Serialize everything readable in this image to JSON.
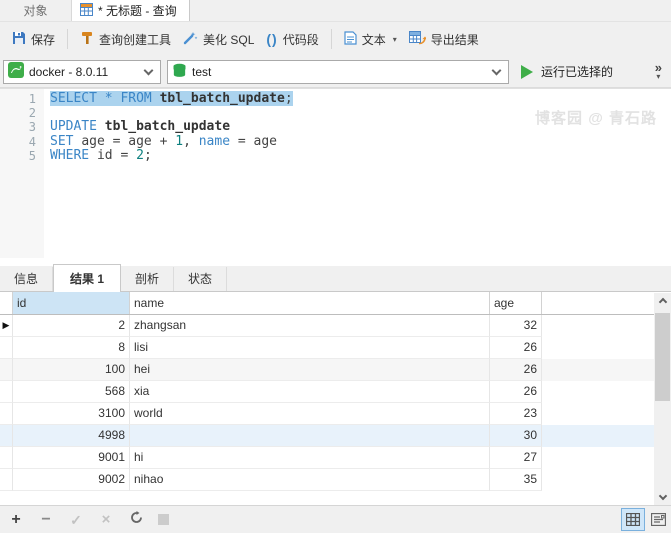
{
  "window_tabs": {
    "objects": {
      "label": "对象"
    },
    "query": {
      "label": "* 无标题 - 查询"
    }
  },
  "toolbar": {
    "save": "保存",
    "query_builder": "查询创建工具",
    "beautify_sql": "美化 SQL",
    "snippet": "代码段",
    "snippet_glyph": "()",
    "text_mode": "文本",
    "export_result": "导出结果",
    "dropdown_glyph": "▾"
  },
  "connection_bar": {
    "connection": "docker - 8.0.11",
    "database": "test",
    "run_selected": "运行已选择的",
    "overflow": "»",
    "overflow_more": "▾"
  },
  "editor": {
    "watermark": "博客园 @ 青石路",
    "lines": [
      {
        "num": "1",
        "selected": true,
        "tokens": [
          {
            "t": "SELECT * FROM ",
            "c": "kw"
          },
          {
            "t": "tbl_batch_update",
            "c": "tbl"
          },
          {
            "t": ";",
            "c": "tx"
          }
        ]
      },
      {
        "num": "2",
        "selected": false,
        "tokens": []
      },
      {
        "num": "3",
        "selected": false,
        "tokens": [
          {
            "t": "UPDATE ",
            "c": "kw"
          },
          {
            "t": "tbl_batch_update",
            "c": "tbl"
          }
        ]
      },
      {
        "num": "4",
        "selected": false,
        "tokens": [
          {
            "t": "SET ",
            "c": "kw"
          },
          {
            "t": "age = age + ",
            "c": "tx"
          },
          {
            "t": "1",
            "c": "num"
          },
          {
            "t": ", ",
            "c": "tx"
          },
          {
            "t": "name",
            "c": "kw"
          },
          {
            "t": " = age",
            "c": "tx"
          }
        ]
      },
      {
        "num": "5",
        "selected": false,
        "tokens": [
          {
            "t": "WHERE ",
            "c": "kw"
          },
          {
            "t": "id = ",
            "c": "tx"
          },
          {
            "t": "2",
            "c": "num"
          },
          {
            "t": ";",
            "c": "tx"
          }
        ]
      }
    ]
  },
  "result_tabs": {
    "info": {
      "label": "信息"
    },
    "result1": {
      "label": "结果 1"
    },
    "profile": {
      "label": "剖析"
    },
    "status": {
      "label": "状态"
    }
  },
  "result_table": {
    "columns": {
      "id": "id",
      "name": "name",
      "age": "age"
    },
    "row_marker": "▶",
    "rows": [
      {
        "id": "2",
        "name": "zhangsan",
        "age": "32",
        "highlight": "none",
        "marker": true
      },
      {
        "id": "8",
        "name": "lisi",
        "age": "26",
        "highlight": "none",
        "marker": false
      },
      {
        "id": "100",
        "name": "hei",
        "age": "26",
        "highlight": "gray",
        "marker": false
      },
      {
        "id": "568",
        "name": "xia",
        "age": "26",
        "highlight": "none",
        "marker": false
      },
      {
        "id": "3100",
        "name": "world",
        "age": "23",
        "highlight": "none",
        "marker": false
      },
      {
        "id": "4998",
        "name": "",
        "age": "30",
        "highlight": "blue",
        "marker": false
      },
      {
        "id": "9001",
        "name": "hi",
        "age": "27",
        "highlight": "none",
        "marker": false
      },
      {
        "id": "9002",
        "name": "nihao",
        "age": "35",
        "highlight": "none",
        "marker": false
      }
    ]
  },
  "bottom_bar": {
    "add": "+",
    "remove": "−",
    "apply": "✓",
    "cancel": "×",
    "stop": ""
  },
  "colors": {
    "keyword": "#3a85c6",
    "number": "#0e807f",
    "selection": "#abd3ee",
    "header_highlight": "#cde4f5",
    "row_highlight_blue": "#e8f2fb",
    "row_highlight_gray": "#f6f6f6",
    "green_accent": "#3fae49",
    "toolbar_bg": "#f0f0f0"
  }
}
